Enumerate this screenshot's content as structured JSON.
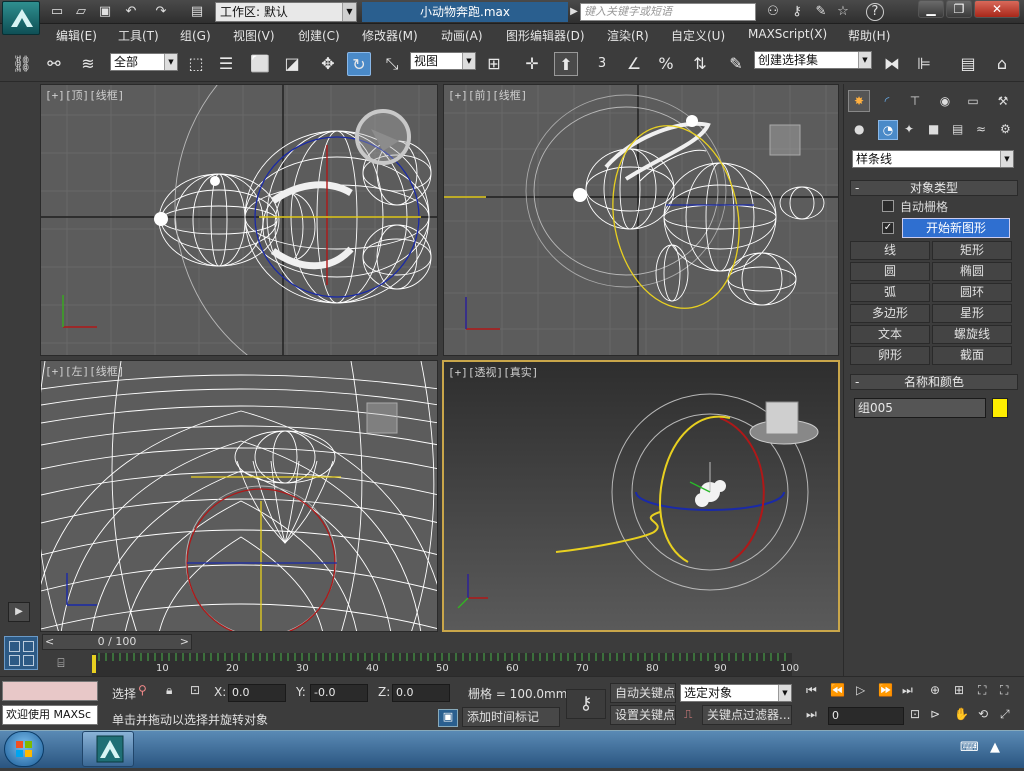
{
  "window": {
    "workspace_label": "工作区: 默认",
    "filename": "小动物奔跑.max",
    "search_placeholder": "键入关键字或短语",
    "help_label": "?"
  },
  "menu": [
    "编辑(E)",
    "工具(T)",
    "组(G)",
    "视图(V)",
    "创建(C)",
    "修改器(M)",
    "动画(A)",
    "图形编辑器(D)",
    "渲染(R)",
    "自定义(U)",
    "MAXScript(X)",
    "帮助(H)"
  ],
  "toolbar": {
    "selection_filter": "全部",
    "reference_coord": "视图",
    "named_selection": "创建选择集",
    "snap_value": "3"
  },
  "viewports": {
    "top": "[+][顶][线框]",
    "front": "[+][前][线框]",
    "left": "[+][左][线框]",
    "perspective": "[+][透视][真实]"
  },
  "command_panel": {
    "category": "样条线",
    "object_type_title": "对象类型",
    "auto_grid_label": "自动栅格",
    "auto_grid_checked": false,
    "start_new_shape_label": "开始新图形",
    "start_new_shape_checked": true,
    "object_buttons": [
      "线",
      "矩形",
      "圆",
      "椭圆",
      "弧",
      "圆环",
      "多边形",
      "星形",
      "文本",
      "螺旋线",
      "卵形",
      "截面"
    ],
    "name_color_title": "名称和颜色",
    "object_name": "组005",
    "object_color": "#ffee00"
  },
  "timeline": {
    "frame_display": "0 / 100",
    "ruler_ticks": [
      "10",
      "20",
      "30",
      "40",
      "50",
      "60",
      "70",
      "80",
      "90",
      "100"
    ]
  },
  "status": {
    "maxscript_welcome": "欢迎使用 MAXSc",
    "selected_label": "选择",
    "x_label": "X:",
    "x_value": "0.0",
    "y_label": "Y:",
    "y_value": "-0.0",
    "z_label": "Z:",
    "z_value": "0.0",
    "grid_label": "栅格 = 100.0mm",
    "prompt": "单击并拖动以选择并旋转对象",
    "add_time_tag": "添加时间标记",
    "auto_key": "自动关键点",
    "set_key": "设置关键点",
    "key_mode": "选定对象",
    "key_filters": "关键点过滤器...",
    "current_frame": "0"
  },
  "colors": {
    "accent": "#2a5f8f",
    "persp_border": "#c9a64a",
    "viewport_bg": "#5c5c5c",
    "wire": "#ffffff",
    "gizmo_yellow": "#e8d020",
    "gizmo_red": "#b01818",
    "gizmo_blue": "#1a2aa8"
  }
}
